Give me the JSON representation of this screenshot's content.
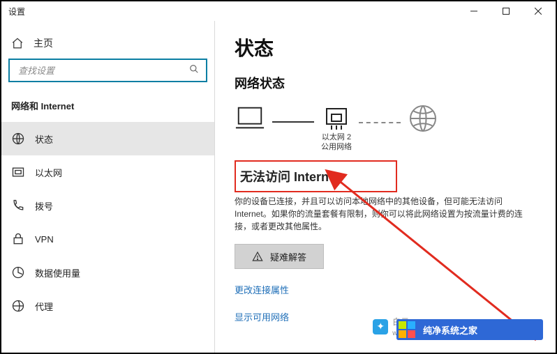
{
  "window": {
    "title": "设置"
  },
  "sidebar": {
    "home_label": "主页",
    "search_placeholder": "查找设置",
    "category": "网络和 Internet",
    "items": [
      {
        "label": "状态"
      },
      {
        "label": "以太网"
      },
      {
        "label": "拨号"
      },
      {
        "label": "VPN"
      },
      {
        "label": "数据使用量"
      },
      {
        "label": "代理"
      }
    ]
  },
  "content": {
    "page_title": "状态",
    "section_title": "网络状态",
    "diagram": {
      "adapter_name": "以太网 2",
      "network_type": "公用网络"
    },
    "alert": "无法访问 Internet",
    "desc": "你的设备已连接，并且可以访问本地网络中的其他设备，但可能无法访问 Internet。如果你的流量套餐有限制，则你可以将此网络设置为按流量计费的连接，或者更改其他属性。",
    "troubleshoot_label": "疑难解答",
    "link_change": "更改连接属性",
    "link_show": "显示可用网络"
  },
  "watermarks": {
    "w1": "纯净系统之家",
    "w2": "白云",
    "w2_domain": "w w w . b a..."
  }
}
